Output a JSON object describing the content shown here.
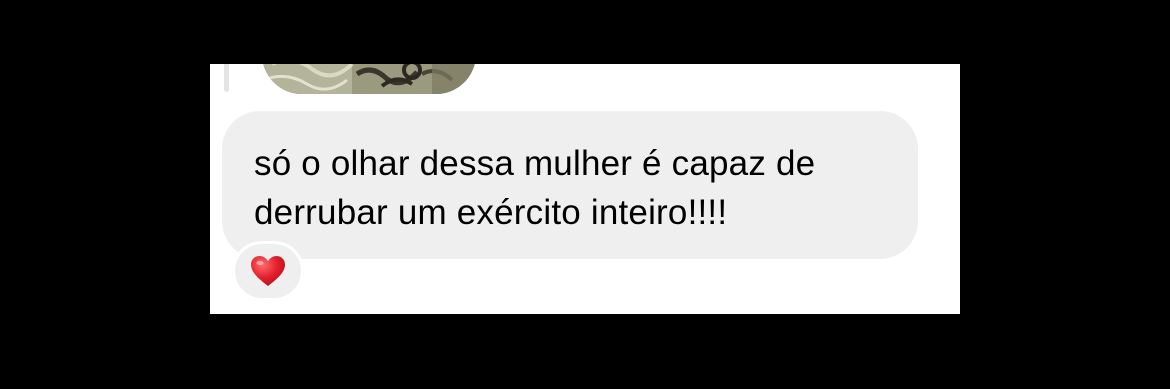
{
  "message": {
    "text": "só o olhar dessa mulher é capaz de\nderrubar um exército inteiro!!!!"
  },
  "reaction": {
    "emoji": "heart",
    "color": "#e5202e"
  },
  "colors": {
    "background": "#000000",
    "panel": "#ffffff",
    "bubble": "#efefef",
    "text": "#000000"
  }
}
